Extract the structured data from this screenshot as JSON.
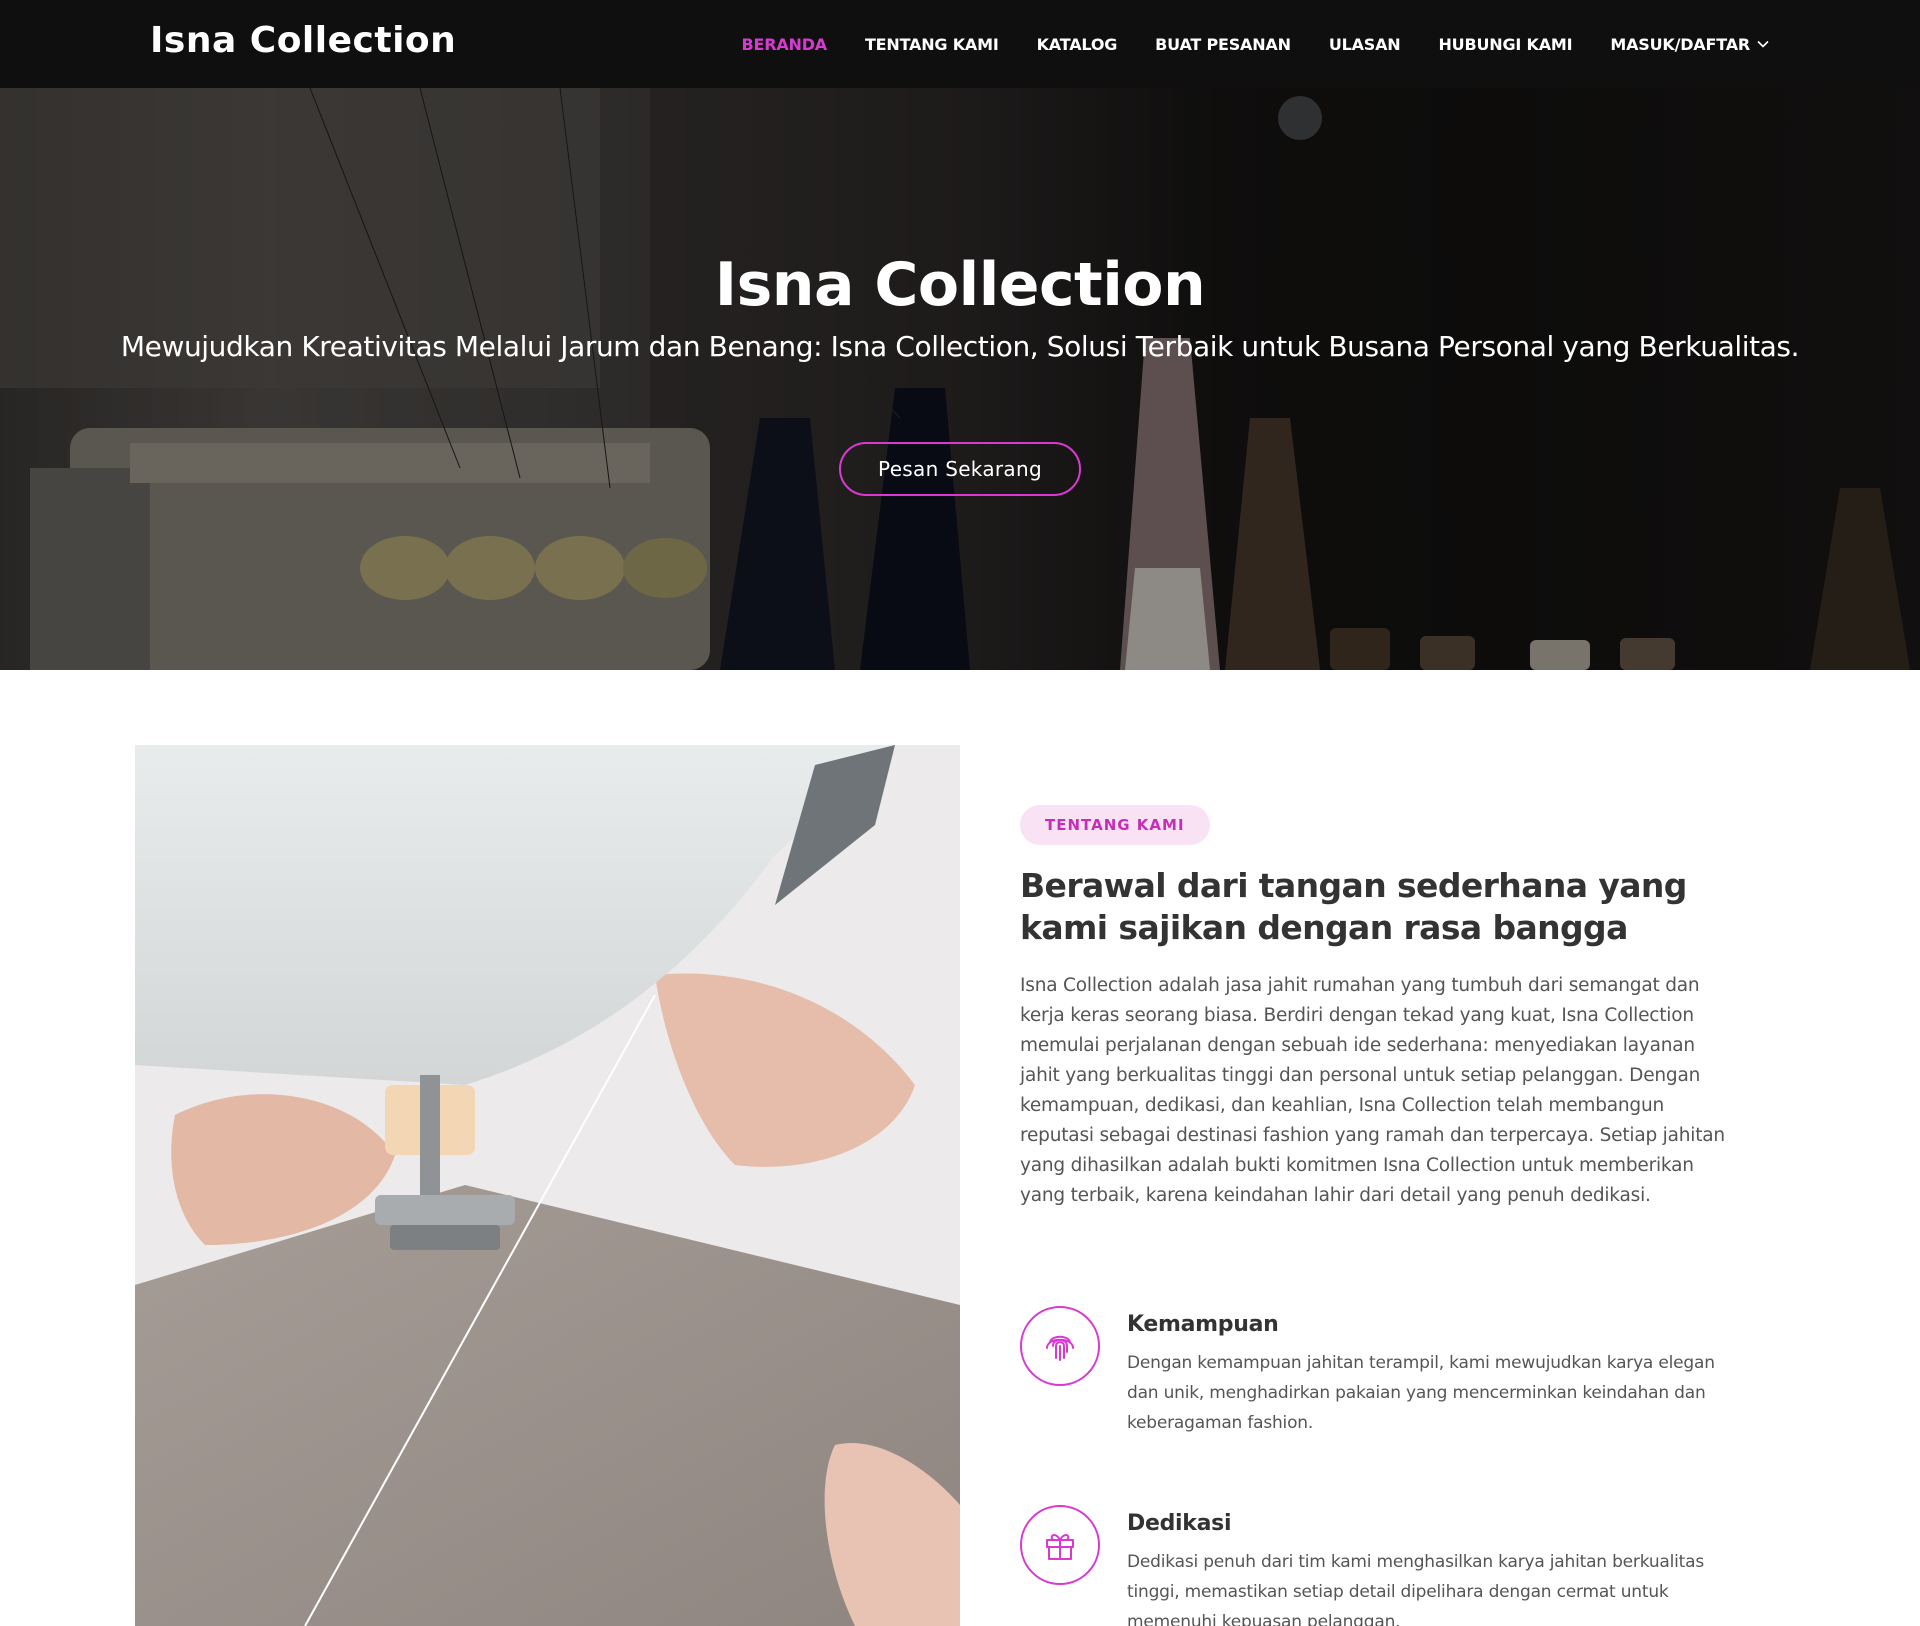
{
  "header": {
    "logo": "Isna Collection",
    "nav": [
      {
        "label": "BERANDA",
        "active": true
      },
      {
        "label": "TENTANG KAMI"
      },
      {
        "label": "KATALOG"
      },
      {
        "label": "BUAT PESANAN"
      },
      {
        "label": "ULASAN"
      },
      {
        "label": "HUBUNGI KAMI"
      },
      {
        "label": "MASUK/DAFTAR",
        "has_dropdown": true
      }
    ]
  },
  "hero": {
    "title": "Isna Collection",
    "subtitle": "Mewujudkan Kreativitas Melalui Jarum dan Benang: Isna Collection, Solusi Terbaik untuk Busana Personal yang Berkualitas.",
    "cta": "Pesan Sekarang"
  },
  "about": {
    "badge": "TENTANG KAMI",
    "title": "Berawal dari tangan sederhana yang kami sajikan dengan rasa bangga",
    "description": "Isna Collection adalah jasa jahit rumahan yang tumbuh dari semangat dan kerja keras seorang biasa. Berdiri dengan tekad yang kuat, Isna Collection memulai perjalanan dengan sebuah ide sederhana: menyediakan layanan jahit yang berkualitas tinggi dan personal untuk setiap pelanggan. Dengan kemampuan, dedikasi, dan keahlian, Isna Collection telah membangun reputasi sebagai destinasi fashion yang ramah dan terpercaya. Setiap jahitan yang dihasilkan adalah bukti komitmen Isna Collection untuk memberikan yang terbaik, karena keindahan lahir dari detail yang penuh dedikasi.",
    "features": [
      {
        "icon": "fingerprint-icon",
        "title": "Kemampuan",
        "description": "Dengan kemampuan jahitan terampil, kami mewujudkan karya elegan dan unik, menghadirkan pakaian yang mencerminkan keindahan dan keberagaman fashion."
      },
      {
        "icon": "gift-icon",
        "title": "Dedikasi",
        "description": "Dedikasi penuh dari tim kami menghasilkan karya jahitan berkualitas tinggi, memastikan setiap detail dipelihara dengan cermat untuk memenuhi kepuasan pelanggan."
      }
    ]
  },
  "colors": {
    "accent": "#d83ad1",
    "header_bg": "#0f0f0f",
    "badge_bg": "#f8e2f4"
  }
}
